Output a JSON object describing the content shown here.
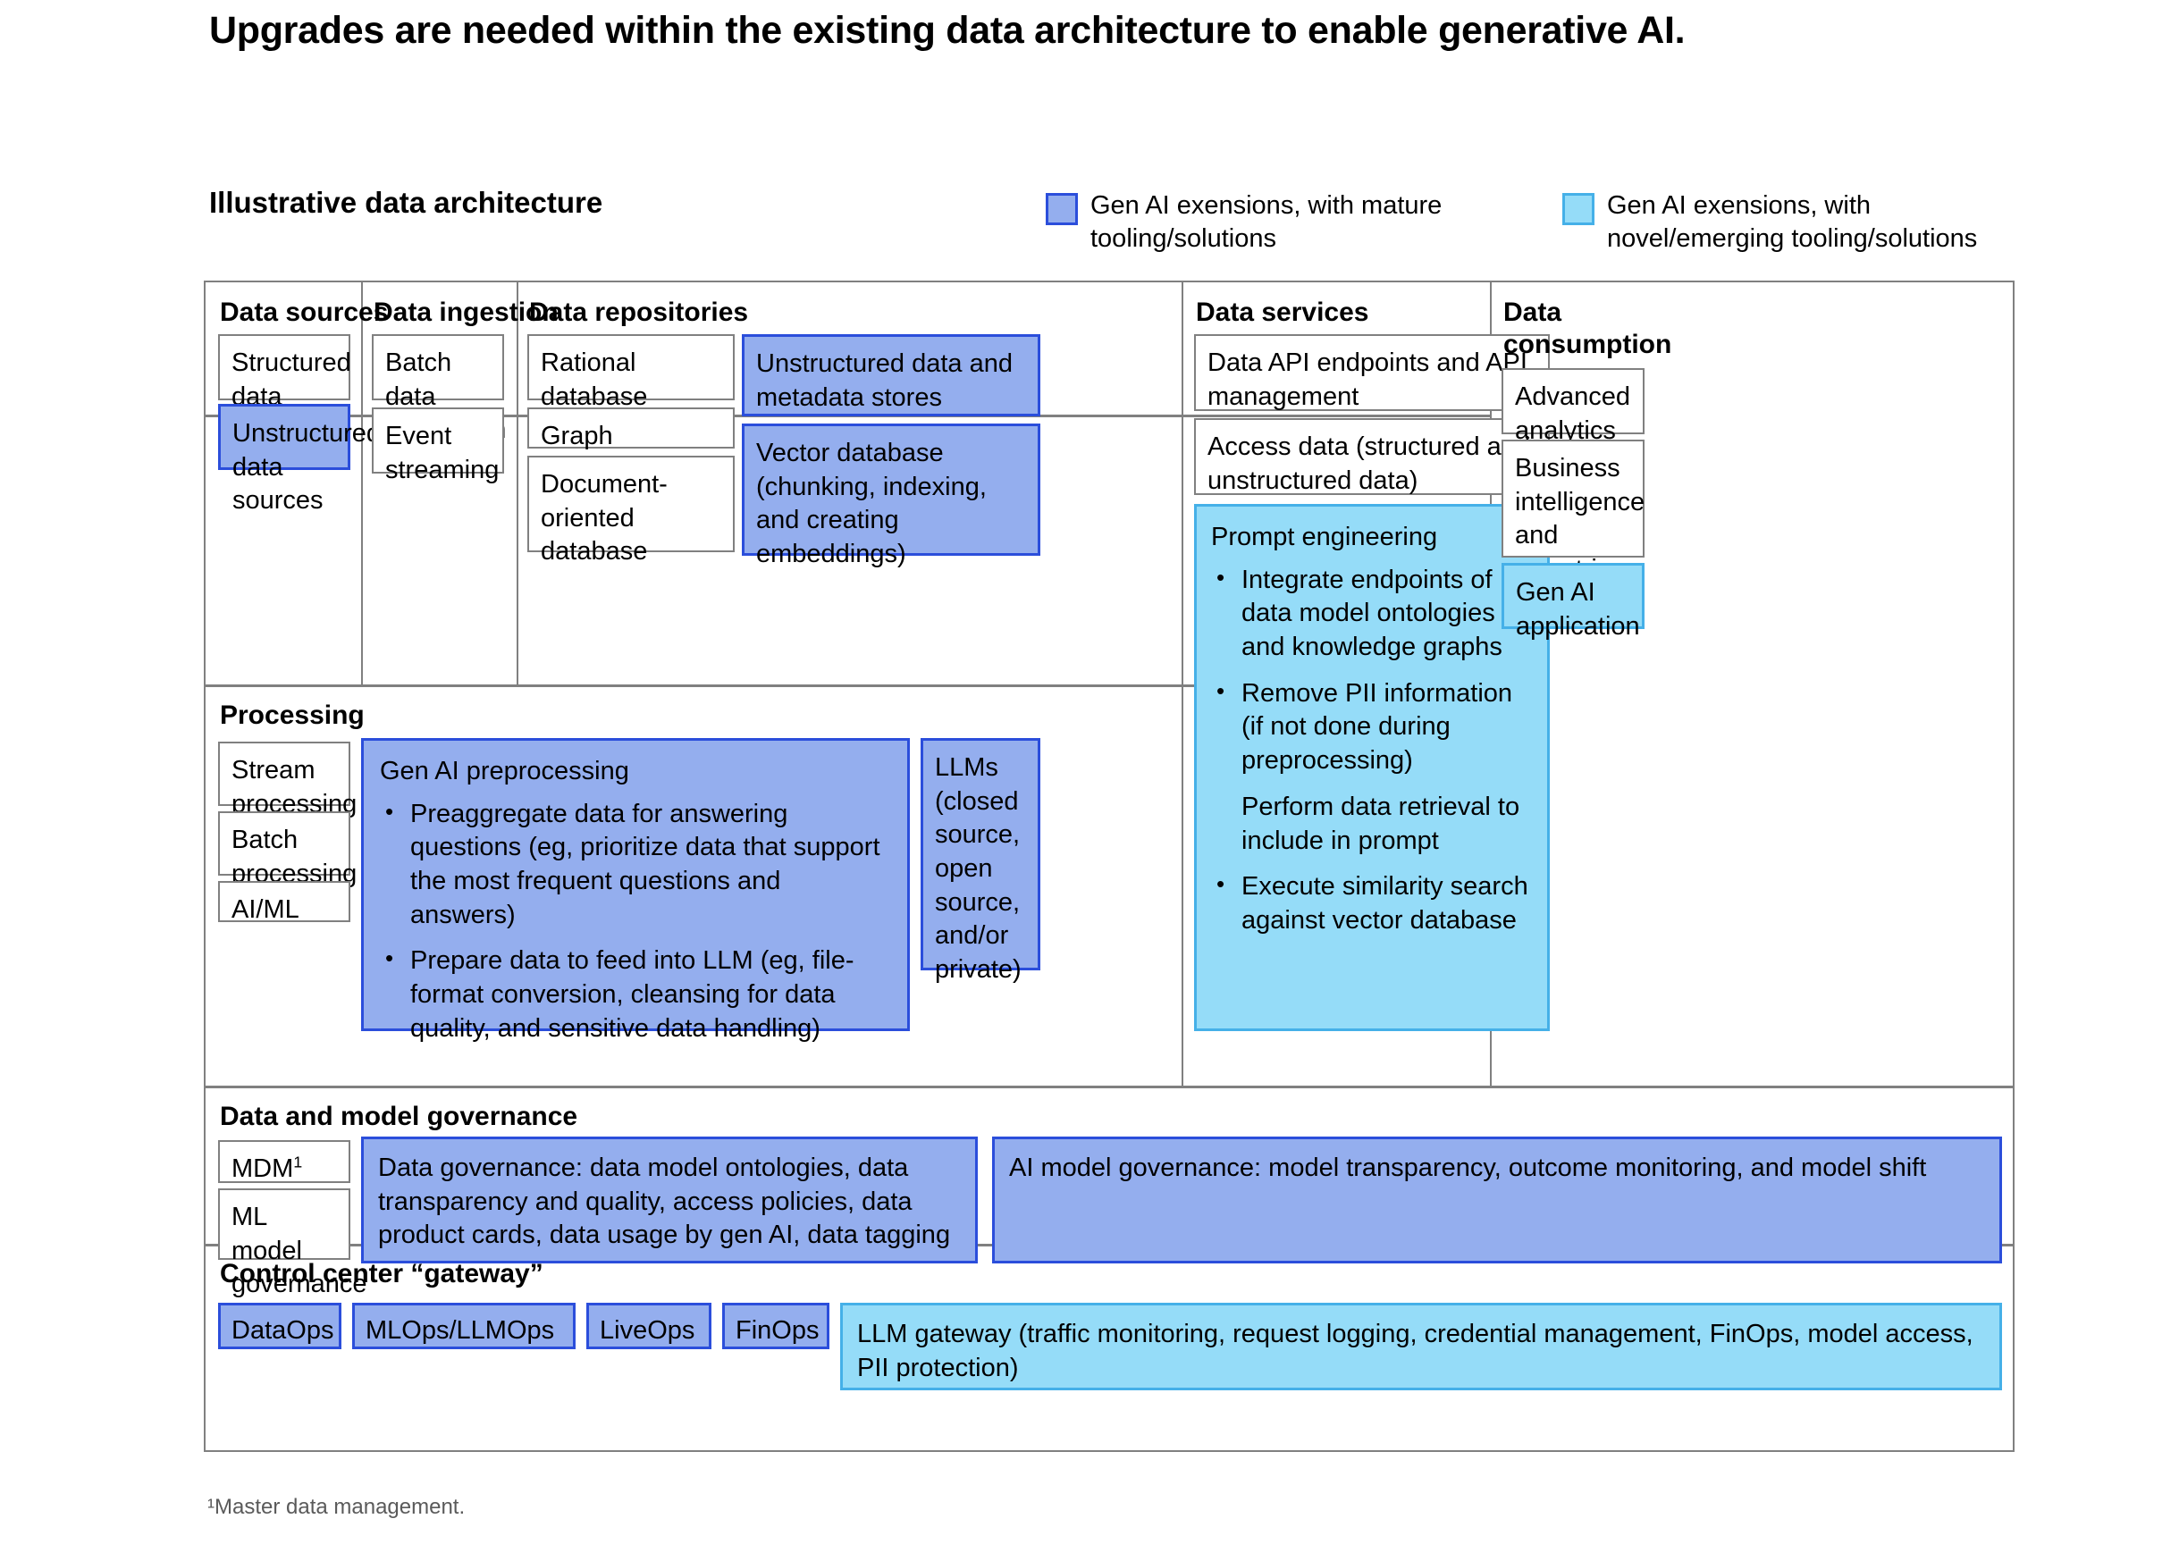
{
  "title": "Upgrades are needed within the existing data architecture to enable generative AI.",
  "subtitle": "Illustrative data architecture",
  "legend": [
    {
      "label": "Gen AI exensions, with mature tooling/solutions",
      "color": "#94AEEE",
      "border": "#2B4EDB",
      "kind": "mature"
    },
    {
      "label": "Gen AI exensions, with novel/emerging tooling/solutions",
      "color": "#95DCF8",
      "border": "#45B0E8",
      "kind": "novel"
    }
  ],
  "columns": {
    "data_sources": {
      "heading": "Data sources",
      "items": [
        {
          "label": "Structured data sources",
          "kind": "plain"
        },
        {
          "label": "Unstructured data sources",
          "kind": "mature"
        }
      ]
    },
    "data_ingestion": {
      "heading": "Data ingestion",
      "items": [
        {
          "label": "Batch data integration",
          "kind": "plain"
        },
        {
          "label": "Event streaming",
          "kind": "plain"
        }
      ]
    },
    "data_repositories": {
      "heading": "Data repositories",
      "items_left": [
        {
          "label": "Rational database",
          "kind": "plain"
        },
        {
          "label": "Graph database",
          "kind": "plain"
        },
        {
          "label": "Document-oriented database",
          "kind": "plain"
        }
      ],
      "items_right": [
        {
          "label": "Unstructured data and metadata stores",
          "kind": "mature"
        },
        {
          "label": "Vector database (chunking, indexing, and creating embeddings)",
          "kind": "mature"
        }
      ]
    },
    "data_services": {
      "heading": "Data services",
      "items": [
        {
          "label": "Data API endpoints and API management",
          "kind": "plain"
        },
        {
          "label": "Access data (structured and unstructured data)",
          "kind": "plain"
        }
      ],
      "prompt_engineering": {
        "title": "Prompt engineering",
        "kind": "novel",
        "bullets": [
          {
            "text": "Integrate endpoints of data model ontologies and knowledge graphs",
            "bullet": true
          },
          {
            "text": "Remove PII information (if not done during preprocessing)",
            "bullet": true
          },
          {
            "text": "Perform data retrieval to include in prompt",
            "bullet": false
          },
          {
            "text": "Execute similarity search against vector database",
            "bullet": true
          }
        ]
      }
    },
    "data_consumption": {
      "heading": "Data consumption",
      "items": [
        {
          "label": "Advanced analytics",
          "kind": "plain"
        },
        {
          "label": "Business intelligence and report-ing",
          "kind": "plain"
        },
        {
          "label": "Gen AI application",
          "kind": "novel"
        }
      ]
    }
  },
  "processing": {
    "heading": "Processing",
    "items": [
      {
        "label": "Stream processing",
        "kind": "plain"
      },
      {
        "label": "Batch processing",
        "kind": "plain"
      },
      {
        "label": "AI/ML",
        "kind": "plain"
      }
    ],
    "gen_ai_preprocessing": {
      "title": "Gen AI preprocessing",
      "kind": "mature",
      "bullets": [
        {
          "text": "Preaggregate data for answering questions (eg, prioritize data that support the most frequent questions and answers)",
          "bullet": true
        },
        {
          "text": "Prepare data to feed into LLM (eg, file-format conversion, cleansing for data quality, and sensitive data handling)",
          "bullet": true
        }
      ]
    },
    "llms": {
      "label": "LLMs (closed source, open source, and/or private)",
      "kind": "mature"
    }
  },
  "governance": {
    "heading": "Data and model governance",
    "items": [
      {
        "label": "MDM",
        "sup": "1",
        "kind": "plain"
      },
      {
        "label": "ML model governance",
        "kind": "plain"
      }
    ],
    "data_governance": {
      "label": "Data governance: data model ontologies, data transparency and quality, access policies, data product cards, data usage by gen AI, data tagging",
      "kind": "mature"
    },
    "ai_model_governance": {
      "label": "AI model governance: model transparency, outcome monitoring, and model shift",
      "kind": "mature"
    }
  },
  "control_center": {
    "heading": "Control center “gateway”",
    "ops": [
      {
        "label": "DataOps",
        "kind": "mature"
      },
      {
        "label": "MLOps/LLMOps",
        "kind": "mature"
      },
      {
        "label": "LiveOps",
        "kind": "mature"
      },
      {
        "label": "FinOps",
        "kind": "mature"
      }
    ],
    "llm_gateway": {
      "label": "LLM gateway (traffic monitoring, request logging, credential management, FinOps, model access, PII protection)",
      "kind": "novel"
    }
  },
  "footnote": "¹Master data management."
}
